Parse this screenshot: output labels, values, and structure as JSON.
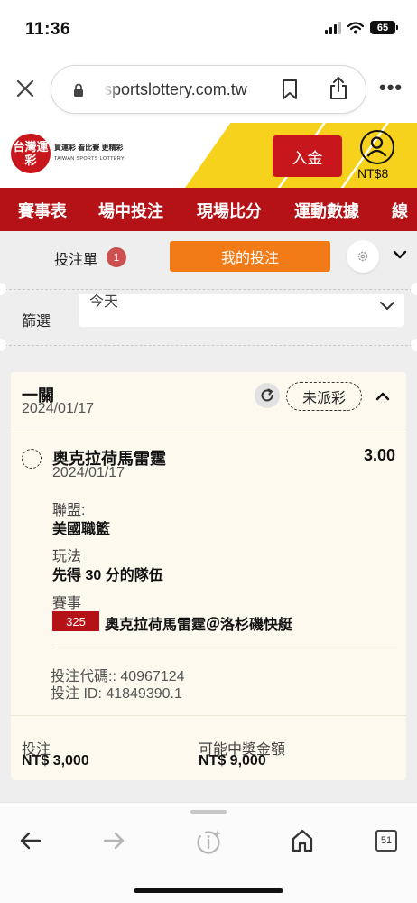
{
  "status_bar": {
    "time": "11:36",
    "battery": "65"
  },
  "browser": {
    "url": "sportslottery.com.tw",
    "tabs_count": "51"
  },
  "site": {
    "logo_text": "台灣運彩",
    "tagline": "買運彩 看比賽 更精彩",
    "subtitle": "TAIWAN SPORTS LOTTERY",
    "deposit_label": "入金",
    "balance": "NT$8"
  },
  "nav": {
    "items": [
      {
        "label": "賽事表"
      },
      {
        "label": "場中投注"
      },
      {
        "label": "現場比分"
      },
      {
        "label": "運動數據"
      },
      {
        "label": "線"
      }
    ]
  },
  "betslip": {
    "label": "投注單",
    "count": "1",
    "my_bets_label": "我的投注"
  },
  "filter": {
    "label": "篩選",
    "value": "今天"
  },
  "bet": {
    "type": "一關",
    "date": "2024/01/17",
    "status": "未派彩",
    "selection": {
      "team": "奧克拉荷馬雷霆",
      "odds": "3.00",
      "date": "2024/01/17",
      "league_label": "聯盟:",
      "league_value": "美國職籃",
      "market_label": "玩法",
      "market_value": "先得 30 分的隊伍",
      "event_label": "賽事",
      "event_code": "325",
      "event_name": "奧克拉荷馬雷霆＠洛杉磯快艇"
    },
    "code_line": "投注代碼:: 40967124",
    "id_line": "投注 ID: 41849390.1",
    "stake_label": "投注",
    "stake_value": "NT$ 3,000",
    "payout_label": "可能中獎金額",
    "payout_value": "NT$ 9,000"
  }
}
